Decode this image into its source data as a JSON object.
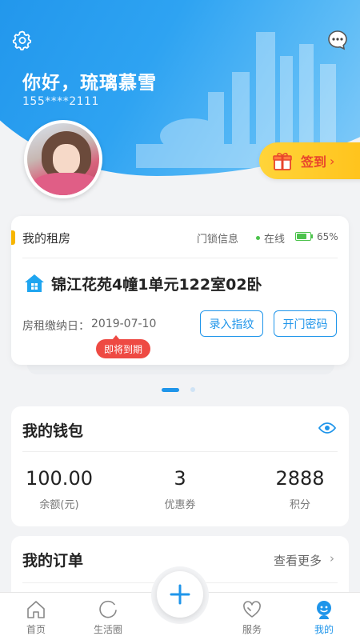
{
  "profile": {
    "greeting": "你好，琉璃慕雪",
    "phone": "155****2111",
    "checkin_label": "签到",
    "checkin_chevron": "›"
  },
  "rental": {
    "title": "我的租房",
    "lock_info": "门锁信息",
    "status": "在线",
    "battery_percent": "65%",
    "battery_level": 0.65,
    "room": "锦江花苑4幢1单元122室02卧",
    "due_label": "房租缴纳日：",
    "due_date": "2019-07-10",
    "fingerprint_button": "录入指纹",
    "password_button": "开门密码",
    "expire_badge": "即将到期"
  },
  "carousel": {
    "active_index": 0,
    "count": 2
  },
  "wallet": {
    "title": "我的钱包",
    "stats": [
      {
        "value": "100.00",
        "label": "余额(元)"
      },
      {
        "value": "3",
        "label": "优惠券"
      },
      {
        "value": "2888",
        "label": "积分"
      }
    ]
  },
  "orders": {
    "title": "我的订单",
    "more": "查看更多",
    "more_chevron": "›"
  },
  "tabbar": {
    "items": [
      {
        "label": "首页",
        "icon": "home-icon"
      },
      {
        "label": "生活圈",
        "icon": "circle-icon"
      },
      {
        "label": "服务",
        "icon": "heart-icon"
      },
      {
        "label": "我的",
        "icon": "profile-icon"
      }
    ],
    "active": "我的"
  },
  "colors": {
    "primary": "#1f95ea",
    "accent_yellow": "#ffc21a",
    "alert_red": "#ee4a43",
    "online_green": "#4cc24c"
  }
}
